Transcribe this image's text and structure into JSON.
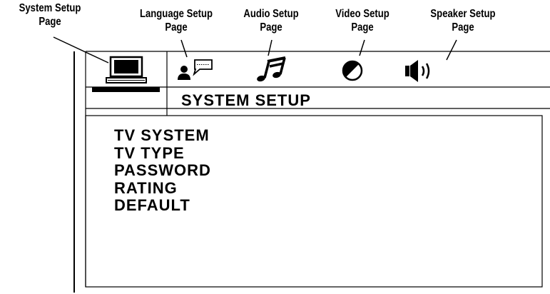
{
  "callouts": {
    "system": {
      "line1": "System Setup",
      "line2": "Page"
    },
    "language": {
      "line1": "Language Setup",
      "line2": "Page"
    },
    "audio": {
      "line1": "Audio Setup",
      "line2": "Page"
    },
    "video": {
      "line1": "Video Setup",
      "line2": "Page"
    },
    "speaker": {
      "line1": "Speaker Setup",
      "line2": "Page"
    }
  },
  "tabs": [
    {
      "icon": "monitor-icon",
      "selected": true
    },
    {
      "icon": "language-icon",
      "selected": false
    },
    {
      "icon": "music-note-icon",
      "selected": false
    },
    {
      "icon": "contrast-icon",
      "selected": false
    },
    {
      "icon": "speaker-icon",
      "selected": false
    }
  ],
  "page_title": "SYSTEM SETUP",
  "menu_items": [
    "TV SYSTEM",
    "TV TYPE",
    "PASSWORD",
    "RATING",
    "DEFAULT"
  ]
}
